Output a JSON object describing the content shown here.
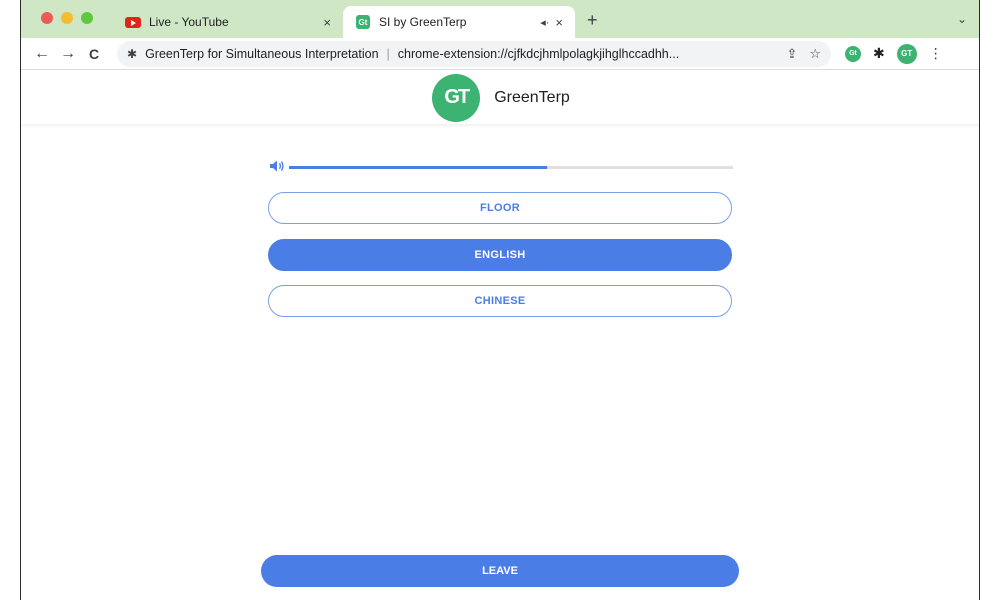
{
  "browser": {
    "tabs": [
      {
        "title": "Live - YouTube",
        "active": false
      },
      {
        "title": "SI by GreenTerp",
        "active": true
      }
    ],
    "omnibox": {
      "site_name": "GreenTerp for Simultaneous Interpretation",
      "url": "chrome-extension://cjfkdcjhmlpolagkjihglhccadhh..."
    },
    "icons": {
      "back": "←",
      "forward": "→",
      "reload": "C",
      "new_tab": "+",
      "tab_close": "×",
      "tab_menu": "⌄",
      "share": "⇪",
      "star": "☆",
      "puzzle": "✱",
      "menu": "⋮",
      "audio": "◂·"
    },
    "extension_badge": "Gt",
    "profile_badge": "GT"
  },
  "app": {
    "logo_text": "GT",
    "name": "GreenTerp",
    "accent_color": "#4a7ee6",
    "brand_color": "#3cb371"
  },
  "volume": {
    "level": 0.58,
    "icon": "speaker-icon"
  },
  "channels": [
    {
      "label": "FLOOR",
      "selected": false
    },
    {
      "label": "ENGLISH",
      "selected": true
    },
    {
      "label": "CHINESE",
      "selected": false
    }
  ],
  "leave_label": "LEAVE"
}
